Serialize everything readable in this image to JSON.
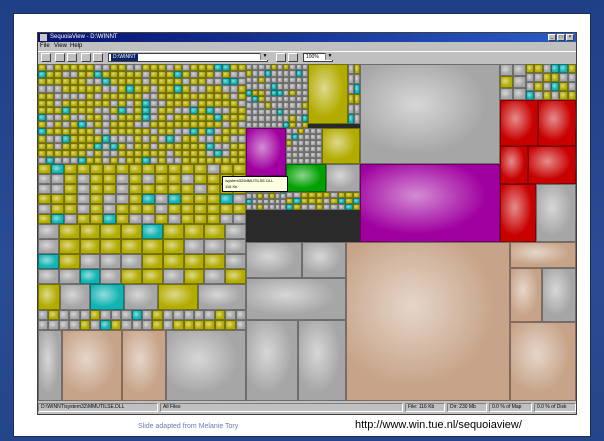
{
  "window": {
    "title": "SequoiaView - D:\\WINNT",
    "minimize_glyph": "_",
    "maximize_glyph": "□",
    "close_glyph": "×"
  },
  "menu": [
    "File",
    "View",
    "Help"
  ],
  "toolbar": {
    "path_value": "D:\\WINNT",
    "zoom_value": "100%",
    "dropdown_glyph": "▼"
  },
  "tooltip": {
    "line1": "\\system32\\MMUTILSE.DLL",
    "line2": "116 Kb"
  },
  "statusbar": {
    "path": "D:\\WINNT\\system32\\MMUTILSE.DLL",
    "filter": "All Files",
    "file_size": "File: 116 Kb",
    "dir_size": "Dir: 230 Mb",
    "map_pct": "0.0 % of Map",
    "disk_pct": "0.0 % of Disk"
  },
  "slide": {
    "caption": "Slide adapted from Melanie Tory",
    "url": "http://www.win.tue.nl/sequoiaview/"
  },
  "colors": {
    "slide_background": "#234488",
    "titlebar": "#06126e",
    "tm_olive": "#b3ac00",
    "tm_gray": "#a6a6a6",
    "tm_cyan": "#12b3b3",
    "tm_magenta": "#a000a0",
    "tm_red": "#c80000",
    "tm_green": "#00a000",
    "tm_tan": "#c7a489"
  }
}
